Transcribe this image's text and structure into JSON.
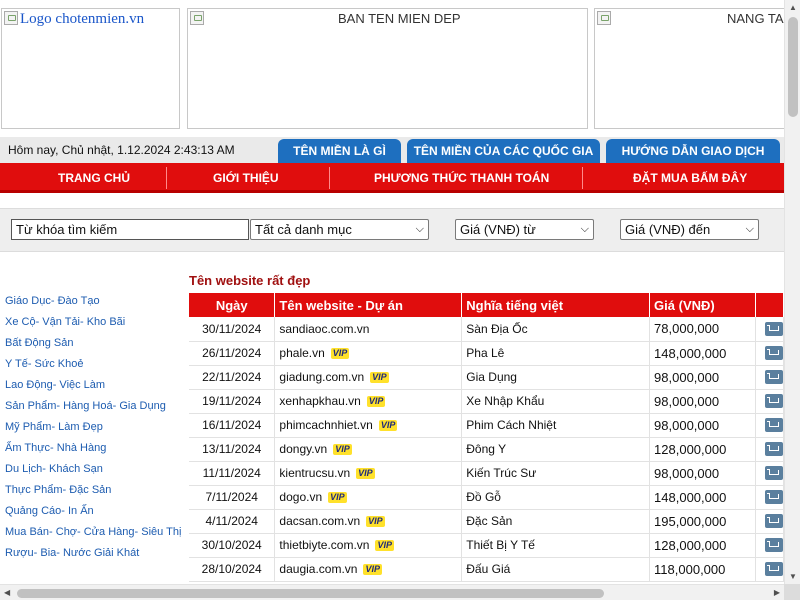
{
  "banners": {
    "logo_alt": "Logo chotenmien.vn",
    "center_alt": "BAN TEN MIEN DEP",
    "right_alt": "NANG TAM"
  },
  "datebar": {
    "text": "Hôm nay, Chủ nhật, 1.12.2024   2:43:13 AM"
  },
  "top_tabs": [
    {
      "label": "TÊN MIỀN LÀ GÌ"
    },
    {
      "label": "TÊN MIỀN CỦA CÁC QUỐC GIA"
    },
    {
      "label": "HƯỚNG DẪN GIAO DỊCH"
    }
  ],
  "main_nav": [
    {
      "label": "TRANG CHỦ"
    },
    {
      "label": "GIỚI THIỆU"
    },
    {
      "label": "PHƯƠNG THỨC THANH TOÁN"
    },
    {
      "label": "ĐẶT MUA BẤM ĐÂY"
    }
  ],
  "search": {
    "keyword_value": "Từ khóa tìm kiếm",
    "category_selected": "Tất cả danh mục",
    "price_from_selected": "Giá (VNĐ) từ",
    "price_to_selected": "Giá (VNĐ) đến"
  },
  "categories": [
    "Giáo Dục- Đào Tạo",
    "Xe Cộ- Vận Tải- Kho Bãi",
    "Bất Động Sản",
    "Y Tế- Sức Khoẻ",
    "Lao Động- Việc Làm",
    "Sản Phẩm- Hàng Hoá- Gia Dụng",
    "Mỹ Phẩm- Làm Đẹp",
    "Ẩm Thực- Nhà Hàng",
    "Du Lịch- Khách Sạn",
    "Thực Phẩm- Đặc Sản",
    "Quảng Cáo- In Ấn",
    "Mua Bán- Chợ- Cửa Hàng- Siêu Thị",
    "Rượu- Bia- Nước Giải Khát"
  ],
  "table": {
    "title": "Tên website rất đẹp",
    "headers": [
      "Ngày",
      "Tên website - Dự án",
      "Nghĩa tiếng việt",
      "Giá (VNĐ)"
    ],
    "vip_label": "VIP",
    "rows": [
      {
        "date": "30/11/2024",
        "domain": "sandiaoc.com.vn",
        "vip": false,
        "meaning": "Sàn Địa Ốc",
        "price": "78,000,000"
      },
      {
        "date": "26/11/2024",
        "domain": "phale.vn",
        "vip": true,
        "meaning": "Pha Lê",
        "price": "148,000,000"
      },
      {
        "date": "22/11/2024",
        "domain": "giadung.com.vn",
        "vip": true,
        "meaning": "Gia Dụng",
        "price": "98,000,000"
      },
      {
        "date": "19/11/2024",
        "domain": "xenhapkhau.vn",
        "vip": true,
        "meaning": "Xe Nhập Khẩu",
        "price": "98,000,000"
      },
      {
        "date": "16/11/2024",
        "domain": "phimcachnhiet.vn",
        "vip": true,
        "meaning": "Phim Cách Nhiệt",
        "price": "98,000,000"
      },
      {
        "date": "13/11/2024",
        "domain": "dongy.vn",
        "vip": true,
        "meaning": "Đông Y",
        "price": "128,000,000"
      },
      {
        "date": "11/11/2024",
        "domain": "kientrucsu.vn",
        "vip": true,
        "meaning": "Kiến Trúc Sư",
        "price": "98,000,000"
      },
      {
        "date": "7/11/2024",
        "domain": "dogo.vn",
        "vip": true,
        "meaning": "Đồ Gỗ",
        "price": "148,000,000"
      },
      {
        "date": "4/11/2024",
        "domain": "dacsan.com.vn",
        "vip": true,
        "meaning": "Đặc Sản",
        "price": "195,000,000"
      },
      {
        "date": "30/10/2024",
        "domain": "thietbiyte.com.vn",
        "vip": true,
        "meaning": "Thiết Bị Y Tế",
        "price": "128,000,000"
      },
      {
        "date": "28/10/2024",
        "domain": "daugia.com.vn",
        "vip": true,
        "meaning": "Đấu Giá",
        "price": "118,000,000"
      }
    ]
  },
  "colors": {
    "nav_red": "#e00d0d",
    "tab_blue": "#1e6fbf",
    "link_blue": "#1d5cb0",
    "title_red": "#a01010",
    "vip_yellow": "#ffe12b"
  },
  "icons": {
    "cart": "cart-icon",
    "broken_image": "broken-image-icon"
  }
}
